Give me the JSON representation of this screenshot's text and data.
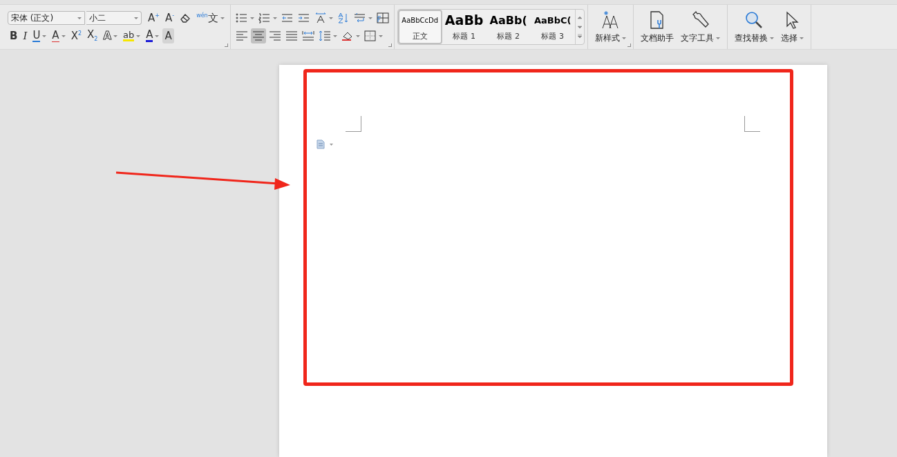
{
  "font_group": {
    "font_name": "宋体 (正文)",
    "font_size": "小二",
    "row1": [
      {
        "kind": "grow",
        "label": "A$^{+}$",
        "dropdown": false
      },
      {
        "kind": "shrink",
        "label": "A$^{-}$",
        "dropdown": false
      },
      {
        "kind": "eraser",
        "dropdown": false
      },
      {
        "kind": "pinyin",
        "label": "$^{wén}$文",
        "dropdown": true
      }
    ],
    "row2": [
      {
        "kind": "bold",
        "label": "B",
        "dropdown": false
      },
      {
        "kind": "italic",
        "label": "I",
        "dropdown": false
      },
      {
        "kind": "underline",
        "label": "U",
        "dropdown": true
      },
      {
        "kind": "strike",
        "label": "A",
        "dropdown": true
      },
      {
        "kind": "super",
        "label": "X$^{2}$",
        "dropdown": false
      },
      {
        "kind": "sub",
        "label": "X$_{2}$",
        "dropdown": false
      },
      {
        "kind": "effect",
        "label": "A",
        "dropdown": true
      },
      {
        "kind": "highlight",
        "label": "ab",
        "dropdown": true
      },
      {
        "kind": "fontcolor",
        "label": "A",
        "dropdown": true
      },
      {
        "kind": "shade",
        "label": "A",
        "dropdown": false
      }
    ]
  },
  "paragraph_group": {
    "row1": [
      {
        "kind": "bullets",
        "dropdown": true,
        "selected": false
      },
      {
        "kind": "numbering",
        "dropdown": true,
        "selected": false
      },
      {
        "kind": "outdent",
        "dropdown": false,
        "selected": false
      },
      {
        "kind": "indent",
        "dropdown": false,
        "selected": false
      },
      {
        "kind": "spacing",
        "dropdown": true,
        "selected": false
      },
      {
        "kind": "sort",
        "dropdown": false,
        "selected": false
      },
      {
        "kind": "direction",
        "dropdown": true,
        "selected": false
      },
      {
        "kind": "table",
        "dropdown": false,
        "selected": false
      }
    ],
    "row2": [
      {
        "kind": "align-left",
        "dropdown": false,
        "selected": false
      },
      {
        "kind": "align-center",
        "dropdown": false,
        "selected": true
      },
      {
        "kind": "align-right",
        "dropdown": false,
        "selected": false
      },
      {
        "kind": "justify",
        "dropdown": false,
        "selected": false
      },
      {
        "kind": "distribute",
        "dropdown": false,
        "selected": false
      },
      {
        "kind": "line-spacing",
        "dropdown": true,
        "selected": false
      },
      {
        "kind": "fill",
        "dropdown": true,
        "selected": false
      },
      {
        "kind": "borders",
        "dropdown": true,
        "selected": false
      }
    ]
  },
  "styles": [
    {
      "kind": "body",
      "preview": "AaBbCcDd",
      "label": "正文",
      "selected": true
    },
    {
      "kind": "h1",
      "preview": "AaBb",
      "label": "标题 1",
      "selected": false
    },
    {
      "kind": "h2",
      "preview": "AaBb(",
      "label": "标题 2",
      "selected": false
    },
    {
      "kind": "h3",
      "preview": "AaBbC(",
      "label": "标题 3",
      "selected": false
    }
  ],
  "big_buttons": [
    {
      "kind": "new-style",
      "label": "新样式",
      "dropdown": true
    },
    {
      "kind": "assistant",
      "label": "文档助手",
      "dropdown": false
    },
    {
      "kind": "tools",
      "label": "文字工具",
      "dropdown": true
    },
    {
      "kind": "find",
      "label": "查找替换",
      "dropdown": true
    },
    {
      "kind": "select",
      "label": "选择",
      "dropdown": true
    }
  ]
}
